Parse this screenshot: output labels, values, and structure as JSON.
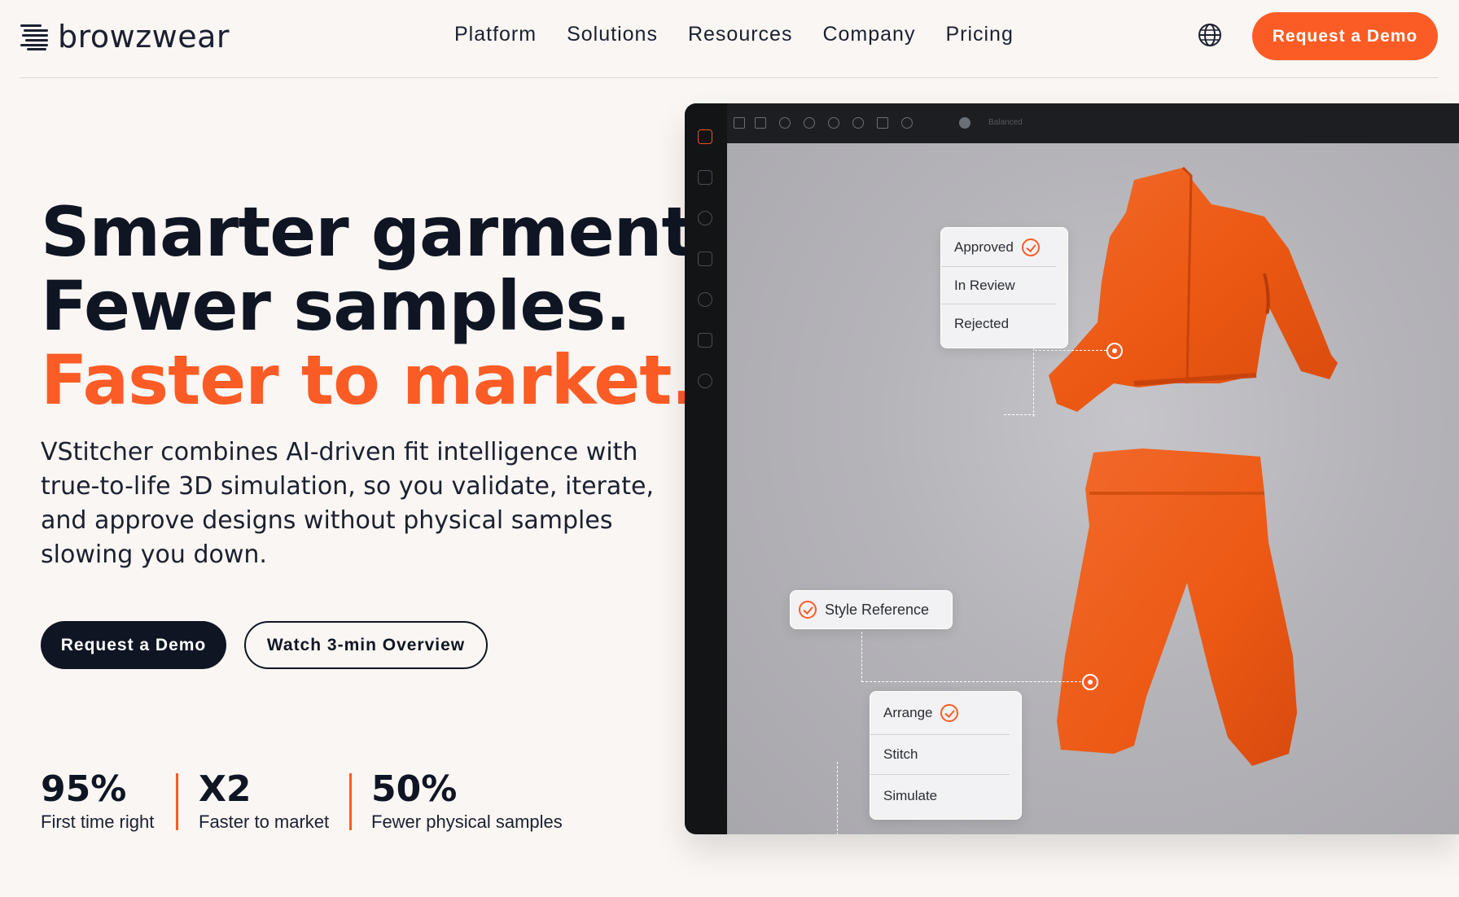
{
  "nav": {
    "logo_text": "browzwear",
    "items": [
      "Platform",
      "Solutions",
      "Resources",
      "Company",
      "Pricing"
    ],
    "cta_label": "Request a Demo"
  },
  "hero": {
    "headline_line1": "Smarter garments.",
    "headline_line2": "Fewer samples.",
    "headline_accent": "Faster to market.",
    "lead": "VStitcher combines AI-driven fit intelligence with true-to-life 3D simulation, so you validate, iterate, and approve designs without physical samples slowing you down.",
    "primary_button": "Request a Demo",
    "secondary_button": "Watch 3-min Overview"
  },
  "stats": [
    {
      "value": "95%",
      "label": "First time right"
    },
    {
      "value": "X2",
      "label": "Faster to market"
    },
    {
      "value": "50%",
      "label": "Fewer physical samples"
    }
  ],
  "app": {
    "toolbar_mode": "Balanced",
    "status_card": [
      "Approved",
      "In Review",
      "Rejected"
    ],
    "style_reference": "Style Reference",
    "workflow_card": [
      "Arrange",
      "Stitch",
      "Simulate"
    ]
  },
  "colors": {
    "accent": "#fb5c25",
    "dark": "#0f1523",
    "background": "#f9f6f3",
    "garment": "#ee5a16"
  }
}
